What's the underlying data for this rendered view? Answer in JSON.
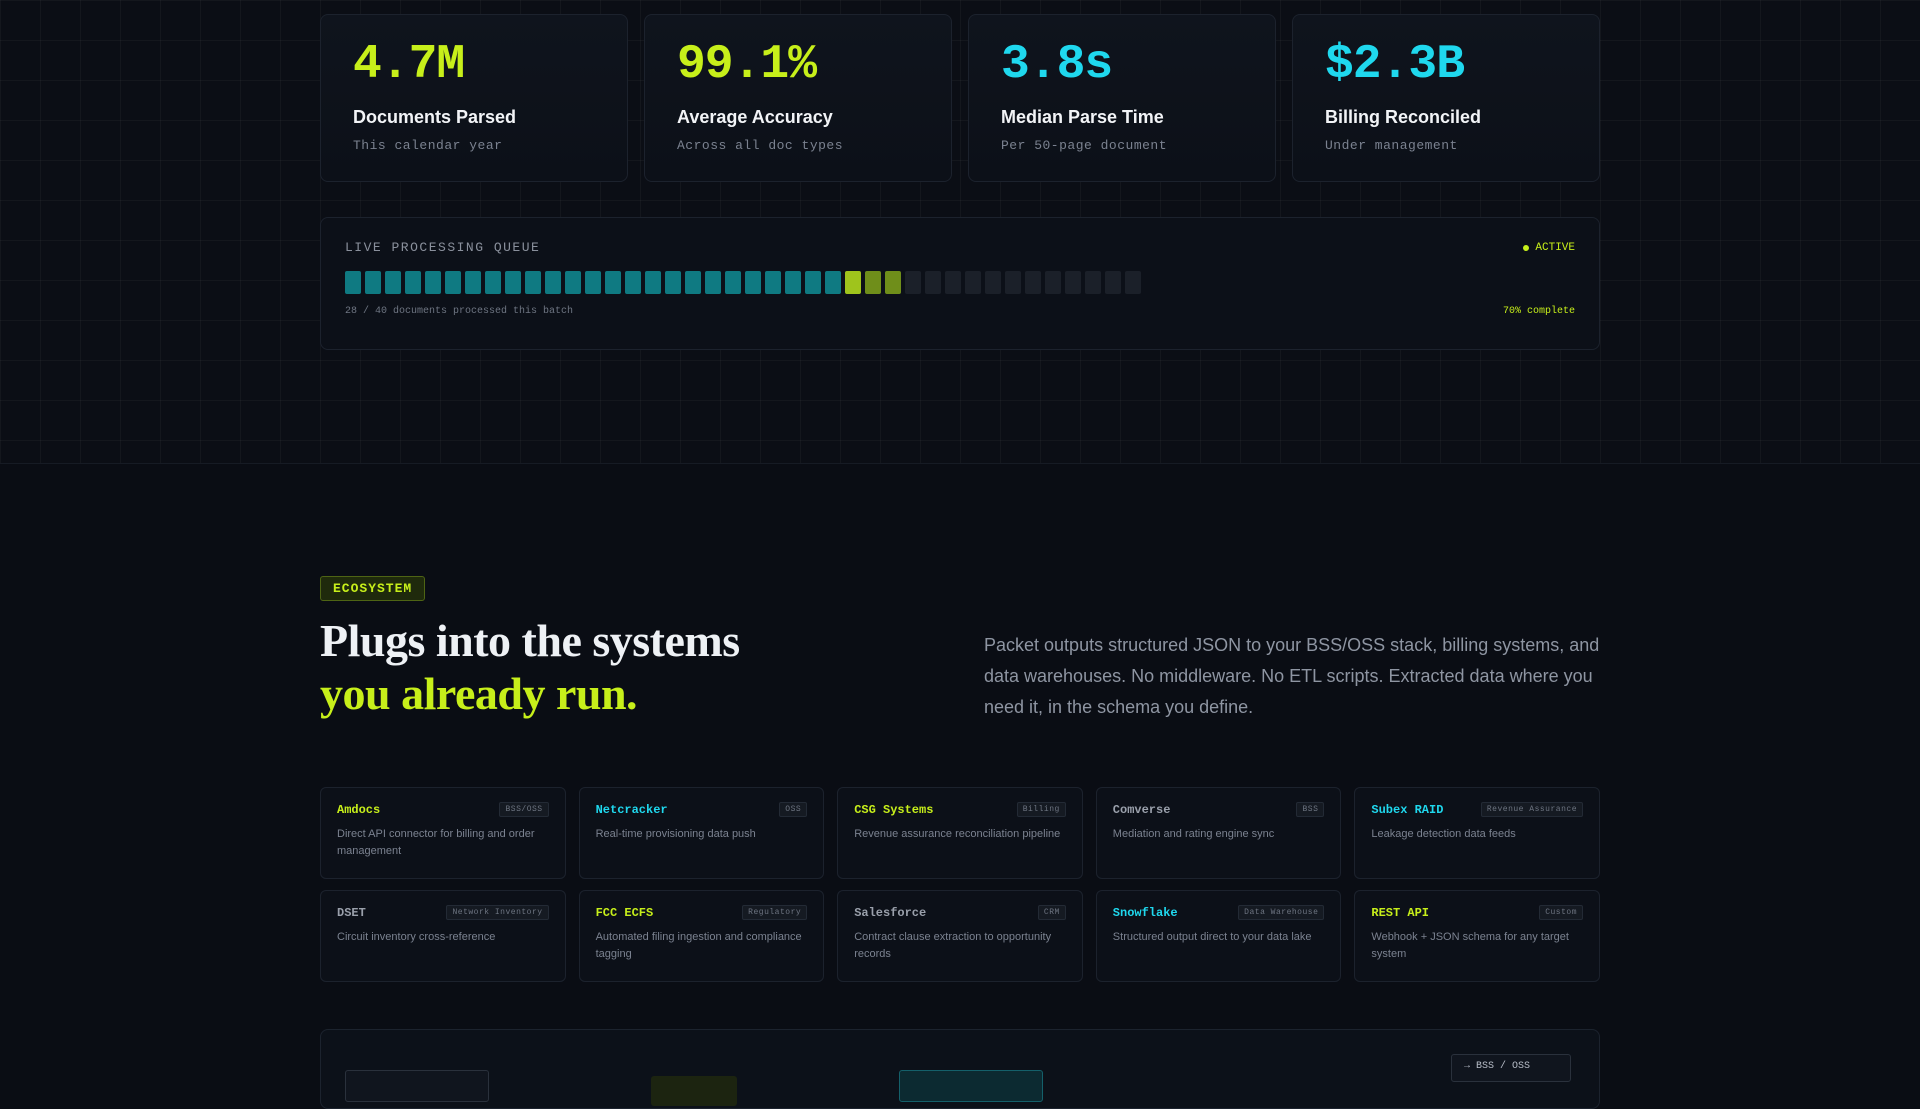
{
  "stats": [
    {
      "value": "4.7M",
      "label": "Documents Parsed",
      "sub": "This calendar year",
      "color": "lime"
    },
    {
      "value": "99.1%",
      "label": "Average Accuracy",
      "sub": "Across all doc types",
      "color": "lime"
    },
    {
      "value": "3.8s",
      "label": "Median Parse Time",
      "sub": "Per 50-page document",
      "color": "cyan"
    },
    {
      "value": "$2.3B",
      "label": "Billing Reconciled",
      "sub": "Under management",
      "color": "cyan"
    }
  ],
  "queue": {
    "title": "LIVE PROCESSING QUEUE",
    "status": "ACTIVE",
    "processed": 25,
    "active": 3,
    "total": 40,
    "footer_left": "28 / 40 documents processed this batch",
    "footer_right": "70% complete"
  },
  "ecosystem": {
    "badge": "ECOSYSTEM",
    "heading_line1": "Plugs into the systems",
    "heading_line2": "you already run.",
    "description": "Packet outputs structured JSON to your BSS/OSS stack, billing systems, and data warehouses. No middleware. No ETL scripts. Extracted data where you need it, in the schema you define."
  },
  "integrations": [
    {
      "name": "Amdocs",
      "tag": "BSS/OSS",
      "desc": "Direct API connector for billing and order management",
      "color": "lime"
    },
    {
      "name": "Netcracker",
      "tag": "OSS",
      "desc": "Real-time provisioning data push",
      "color": "cyan"
    },
    {
      "name": "CSG Systems",
      "tag": "Billing",
      "desc": "Revenue assurance reconciliation pipeline",
      "color": "lime"
    },
    {
      "name": "Comverse",
      "tag": "BSS",
      "desc": "Mediation and rating engine sync",
      "color": "gray"
    },
    {
      "name": "Subex RAID",
      "tag": "Revenue Assurance",
      "desc": "Leakage detection data feeds",
      "color": "cyan"
    },
    {
      "name": "DSET",
      "tag": "Network Inventory",
      "desc": "Circuit inventory cross-reference",
      "color": "gray"
    },
    {
      "name": "FCC ECFS",
      "tag": "Regulatory",
      "desc": "Automated filing ingestion and compliance tagging",
      "color": "lime"
    },
    {
      "name": "Salesforce",
      "tag": "CRM",
      "desc": "Contract clause extraction to opportunity records",
      "color": "gray"
    },
    {
      "name": "Snowflake",
      "tag": "Data Warehouse",
      "desc": "Structured output direct to your data lake",
      "color": "cyan"
    },
    {
      "name": "REST API",
      "tag": "Custom",
      "desc": "Webhook + JSON schema for any target system",
      "color": "lime"
    }
  ],
  "bottom": {
    "output_label": "→ BSS / OSS"
  },
  "colors": {
    "lime": "#c7ef1a",
    "cyan": "#1fd8ee",
    "gray": "#9aa0ab",
    "background": "#0a0d14"
  }
}
